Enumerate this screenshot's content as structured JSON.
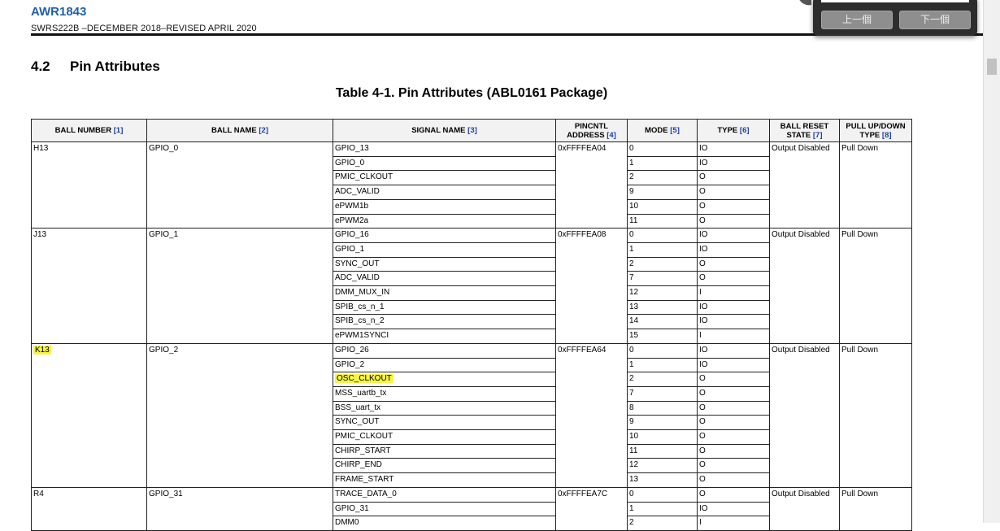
{
  "document": {
    "title": "AWR1843",
    "subtitle": "SWRS222B –DECEMBER 2018–REVISED APRIL 2020"
  },
  "section": {
    "number": "4.2",
    "title": "Pin Attributes"
  },
  "table": {
    "caption": "Table 4-1. Pin Attributes (ABL0161 Package)",
    "headers": [
      {
        "label": "BALL NUMBER",
        "ref": "[1]"
      },
      {
        "label": "BALL NAME",
        "ref": "[2]"
      },
      {
        "label": "SIGNAL NAME",
        "ref": "[3]"
      },
      {
        "label": "PINCNTL ADDRESS",
        "ref": "[4]"
      },
      {
        "label": "MODE",
        "ref": "[5]"
      },
      {
        "label": "TYPE",
        "ref": "[6]"
      },
      {
        "label": "BALL RESET STATE",
        "ref": "[7]"
      },
      {
        "label": "PULL UP/DOWN TYPE",
        "ref": "[8]"
      }
    ],
    "groups": [
      {
        "ball_number": "H13",
        "ball_name": "GPIO_0",
        "address": "0xFFFFEA04",
        "reset_state": "Output Disabled",
        "pull": "Pull Down",
        "signals": [
          {
            "signal": "GPIO_13",
            "mode": "0",
            "type": "IO"
          },
          {
            "signal": "GPIO_0",
            "mode": "1",
            "type": "IO"
          },
          {
            "signal": "PMIC_CLKOUT",
            "mode": "2",
            "type": "O"
          },
          {
            "signal": "ADC_VALID",
            "mode": "9",
            "type": "O"
          },
          {
            "signal": "ePWM1b",
            "mode": "10",
            "type": "O"
          },
          {
            "signal": "ePWM2a",
            "mode": "11",
            "type": "O"
          }
        ]
      },
      {
        "ball_number": "J13",
        "ball_name": "GPIO_1",
        "address": "0xFFFFEA08",
        "reset_state": "Output Disabled",
        "pull": "Pull Down",
        "signals": [
          {
            "signal": "GPIO_16",
            "mode": "0",
            "type": "IO"
          },
          {
            "signal": "GPIO_1",
            "mode": "1",
            "type": "IO"
          },
          {
            "signal": "SYNC_OUT",
            "mode": "2",
            "type": "O"
          },
          {
            "signal": "ADC_VALID",
            "mode": "7",
            "type": "O"
          },
          {
            "signal": "DMM_MUX_IN",
            "mode": "12",
            "type": "I"
          },
          {
            "signal": "SPIB_cs_n_1",
            "mode": "13",
            "type": "IO"
          },
          {
            "signal": "SPIB_cs_n_2",
            "mode": "14",
            "type": "IO"
          },
          {
            "signal": "ePWM1SYNCI",
            "mode": "15",
            "type": "I"
          }
        ]
      },
      {
        "ball_number": "K13",
        "ball_number_highlight": true,
        "ball_name": "GPIO_2",
        "address": "0xFFFFEA64",
        "reset_state": "Output Disabled",
        "pull": "Pull Down",
        "signals": [
          {
            "signal": "GPIO_26",
            "mode": "0",
            "type": "IO"
          },
          {
            "signal": "GPIO_2",
            "mode": "1",
            "type": "IO"
          },
          {
            "signal": "OSC_CLKOUT",
            "mode": "2",
            "type": "O",
            "highlight": true
          },
          {
            "signal": "MSS_uartb_tx",
            "mode": "7",
            "type": "O"
          },
          {
            "signal": "BSS_uart_tx",
            "mode": "8",
            "type": "O"
          },
          {
            "signal": "SYNC_OUT",
            "mode": "9",
            "type": "O"
          },
          {
            "signal": "PMIC_CLKOUT",
            "mode": "10",
            "type": "O"
          },
          {
            "signal": "CHIRP_START",
            "mode": "11",
            "type": "O"
          },
          {
            "signal": "CHIRP_END",
            "mode": "12",
            "type": "O"
          },
          {
            "signal": "FRAME_START",
            "mode": "13",
            "type": "O"
          }
        ]
      },
      {
        "ball_number": "R4",
        "ball_name": "GPIO_31",
        "address": "0xFFFFEA7C",
        "reset_state": "Output Disabled",
        "pull": "Pull Down",
        "signals": [
          {
            "signal": "TRACE_DATA_0",
            "mode": "0",
            "type": "O"
          },
          {
            "signal": "GPIO_31",
            "mode": "1",
            "type": "IO"
          },
          {
            "signal": "DMM0",
            "mode": "2",
            "type": "I"
          }
        ]
      }
    ]
  },
  "popup": {
    "prev_label": "上一個",
    "next_label": "下一個"
  },
  "colors": {
    "highlight": "#f6f347",
    "title_blue": "#1f5fa8"
  }
}
